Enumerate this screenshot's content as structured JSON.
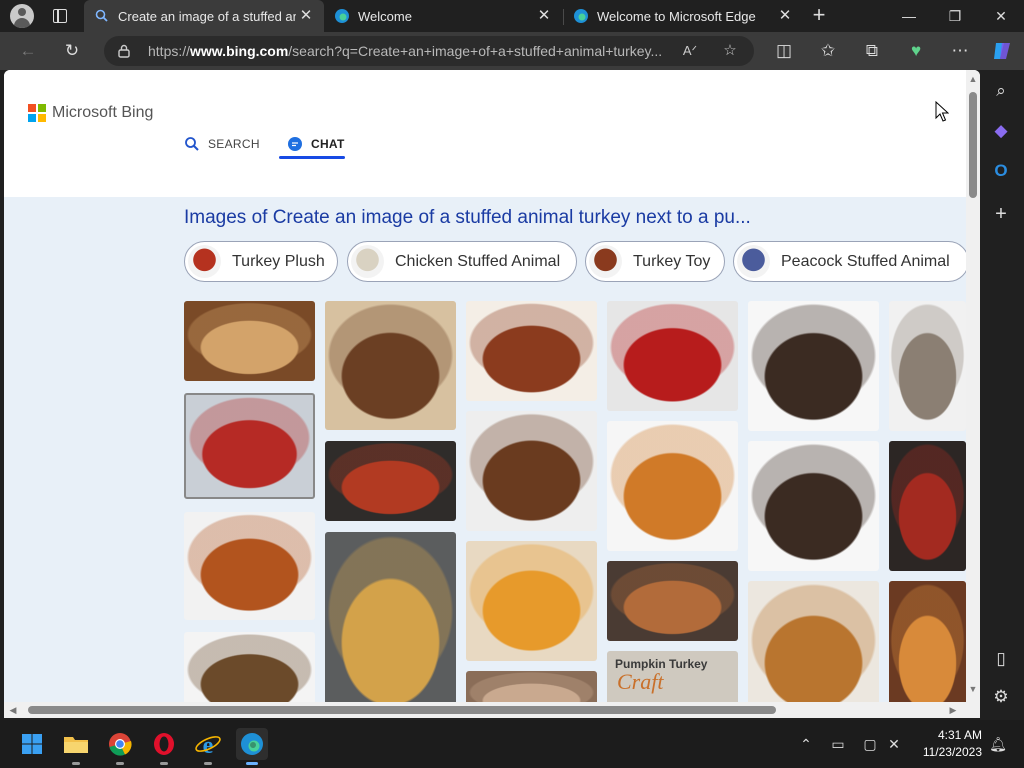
{
  "browser": {
    "tabs": [
      {
        "title": "Create an image of a stuffed animal turkey",
        "active": true
      },
      {
        "title": "Welcome",
        "active": false
      },
      {
        "title": "Welcome to Microsoft Edge",
        "active": false
      }
    ],
    "tab_close_glyph": "✕",
    "new_tab_glyph": "+",
    "window_controls": {
      "minimize": "—",
      "restore": "❐",
      "close": "✕"
    },
    "address": {
      "prefix": "https://",
      "host": "www.bing.com",
      "path": "/search?q=Create+an+image+of+a+stuffed+animal+turkey..."
    }
  },
  "bing": {
    "logo_text": "Microsoft Bing",
    "logo_colors": [
      "#f25022",
      "#7fba00",
      "#00a4ef",
      "#ffb900"
    ],
    "nav": {
      "search": "SEARCH",
      "chat": "CHAT"
    },
    "results_title": "Images of Create an image of a stuffed animal turkey next to a pu...",
    "related_pills": [
      {
        "label": "Turkey Plush",
        "thumb_color": "#b5321f"
      },
      {
        "label": "Chicken Stuffed Animal",
        "thumb_color": "#d9d2c2"
      },
      {
        "label": "Turkey Toy",
        "thumb_color": "#8a3a1e"
      },
      {
        "label": "Peacock Stuffed Animal",
        "thumb_color": "#4b5c9c"
      }
    ],
    "image_tiles": [
      {
        "name": "roast-turkey-dinner",
        "colors": [
          "#7a4a27",
          "#d3a36a"
        ]
      },
      {
        "name": "plush-turkey-framed",
        "colors": [
          "#c9cfd6",
          "#b62a25"
        ]
      },
      {
        "name": "turkey-pilgrim-hat-plush",
        "colors": [
          "#f2f2f2",
          "#b2541e"
        ]
      },
      {
        "name": "rainbow-turkey-plush",
        "colors": [
          "#f4f4f4",
          "#6b4a2a"
        ]
      },
      {
        "name": "turkey-plush-on-table",
        "colors": [
          "#d7c1a0",
          "#6b3f23"
        ]
      },
      {
        "name": "two-turkey-plushes",
        "colors": [
          "#2f2c2a",
          "#b23a22"
        ]
      },
      {
        "name": "stuffed-acorn-squash",
        "colors": [
          "#5b5d5e",
          "#d3a24a"
        ]
      },
      {
        "name": "beanie-turkey-plush",
        "colors": [
          "#f4eee6",
          "#8b3b1e"
        ]
      },
      {
        "name": "round-turkey-plush",
        "colors": [
          "#eeeeee",
          "#6a3b1f"
        ]
      },
      {
        "name": "fan-tail-turkey-plush",
        "colors": [
          "#e8d9c2",
          "#e79a2b"
        ]
      },
      {
        "name": "turkey-plush-partial",
        "colors": [
          "#8a6d58",
          "#c9a98f"
        ]
      },
      {
        "name": "red-turkey-plush",
        "colors": [
          "#e6e6e6",
          "#b71c1c"
        ]
      },
      {
        "name": "turkey-plush-with-tag",
        "colors": [
          "#f6f6f6",
          "#d07a28"
        ]
      },
      {
        "name": "turkey-feast",
        "colors": [
          "#4a3b33",
          "#b26b3a"
        ]
      },
      {
        "name": "pumpkin-turkey-craft",
        "colors": [
          "#cfc9bf",
          "#7a7a7a"
        ],
        "text_line1": "Pumpkin Turkey",
        "text_line2": "Craft"
      },
      {
        "name": "blue-head-turkey-plush",
        "colors": [
          "#f7f7f7",
          "#3b2b22"
        ]
      },
      {
        "name": "blue-head-turkey-plush-2",
        "colors": [
          "#f7f7f7",
          "#3b2b22"
        ]
      },
      {
        "name": "roast-turkey-platter",
        "colors": [
          "#ece7df",
          "#b9752f"
        ]
      },
      {
        "name": "gray-turkey-plush",
        "colors": [
          "#f1f1f1",
          "#8b7f73"
        ]
      },
      {
        "name": "dark-turkey-plush",
        "colors": [
          "#2c2624",
          "#a32a20"
        ]
      },
      {
        "name": "turkey-centerpiece",
        "colors": [
          "#6b3a22",
          "#d88a3a"
        ]
      }
    ]
  },
  "taskbar": {
    "apps": [
      "windows-start",
      "file-explorer",
      "chrome",
      "opera",
      "internet-explorer",
      "edge"
    ],
    "time": "4:31 AM",
    "date": "11/23/2023"
  }
}
